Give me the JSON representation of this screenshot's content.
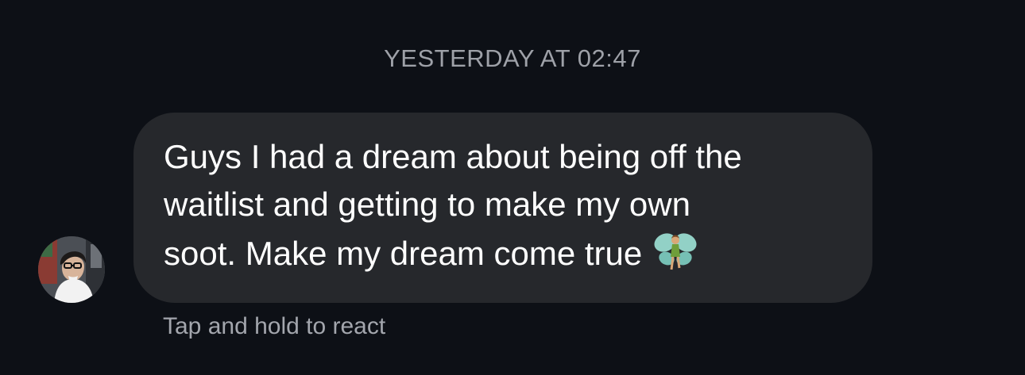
{
  "thread": {
    "timestamp": "YESTERDAY AT 02:47"
  },
  "message": {
    "sender_avatar": "avatar-photo",
    "text": "Guys I had a dream about being off the\nwaitlist and getting to make my own\nsoot. Make my dream come true",
    "emoji": "fairy",
    "react_hint": "Tap and hold to react"
  },
  "colors": {
    "background": "#0d1016",
    "bubble": "#26282c",
    "text": "#ffffff",
    "secondary_text": "#9ea1a8"
  }
}
